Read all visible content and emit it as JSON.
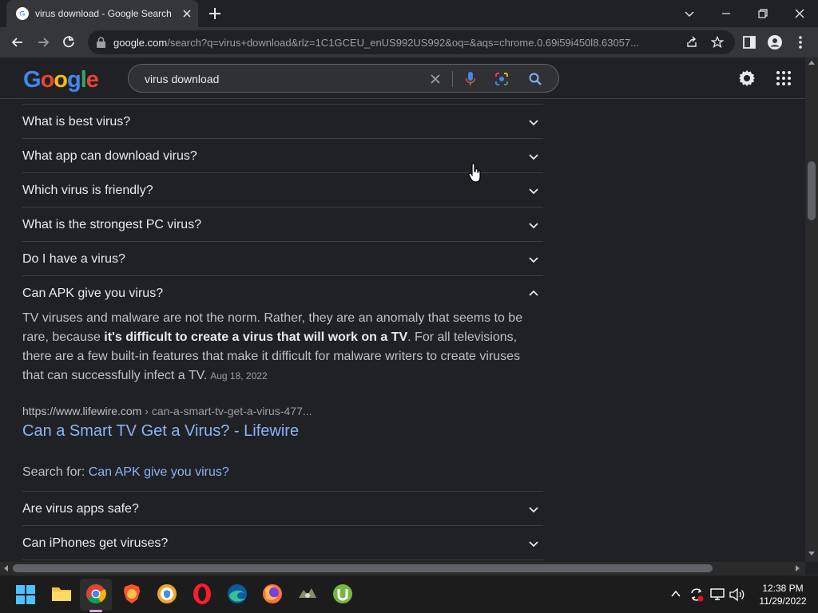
{
  "browser": {
    "tab_title": "virus download - Google Search",
    "url_host": "google.com",
    "url_rest": "/search?q=virus+download&rlz=1C1GCEU_enUS992US992&oq=&aqs=chrome.0.69i59i450l8.63057..."
  },
  "google": {
    "logo_letters": [
      "G",
      "o",
      "o",
      "g",
      "l",
      "e"
    ],
    "logo_colors": [
      "#4285f4",
      "#ea4335",
      "#fbbc05",
      "#4285f4",
      "#34a853",
      "#ea4335"
    ],
    "search_value": "virus download"
  },
  "paa": {
    "questions": [
      {
        "text": "What is best virus?"
      },
      {
        "text": "What app can download virus?"
      },
      {
        "text": "Which virus is friendly?"
      },
      {
        "text": "What is the strongest PC virus?"
      },
      {
        "text": "Do I have a virus?"
      },
      {
        "text": "Can APK give you virus?"
      }
    ],
    "answer_pre": "TV viruses and malware are not the norm. Rather, they are an anomaly that seems to be rare, because ",
    "answer_bold": "it's difficult to create a virus that will work on a TV",
    "answer_post": ". For all televisions, there are a few built-in features that make it difficult for malware writers to create viruses that can successfully infect a TV.",
    "answer_date": "Aug 18, 2022",
    "cite_host": "https://www.lifewire.com",
    "cite_path": " › can-a-smart-tv-get-a-virus-477...",
    "result_title": "Can a Smart TV Get a Virus? - Lifewire",
    "search_for_label": "Search for: ",
    "search_for_link": "Can APK give you virus?",
    "more_questions": [
      {
        "text": "Are virus apps safe?"
      },
      {
        "text": "Can iPhones get viruses?"
      }
    ]
  },
  "taskbar": {
    "time": "12:38 PM",
    "date": "11/29/2022"
  }
}
